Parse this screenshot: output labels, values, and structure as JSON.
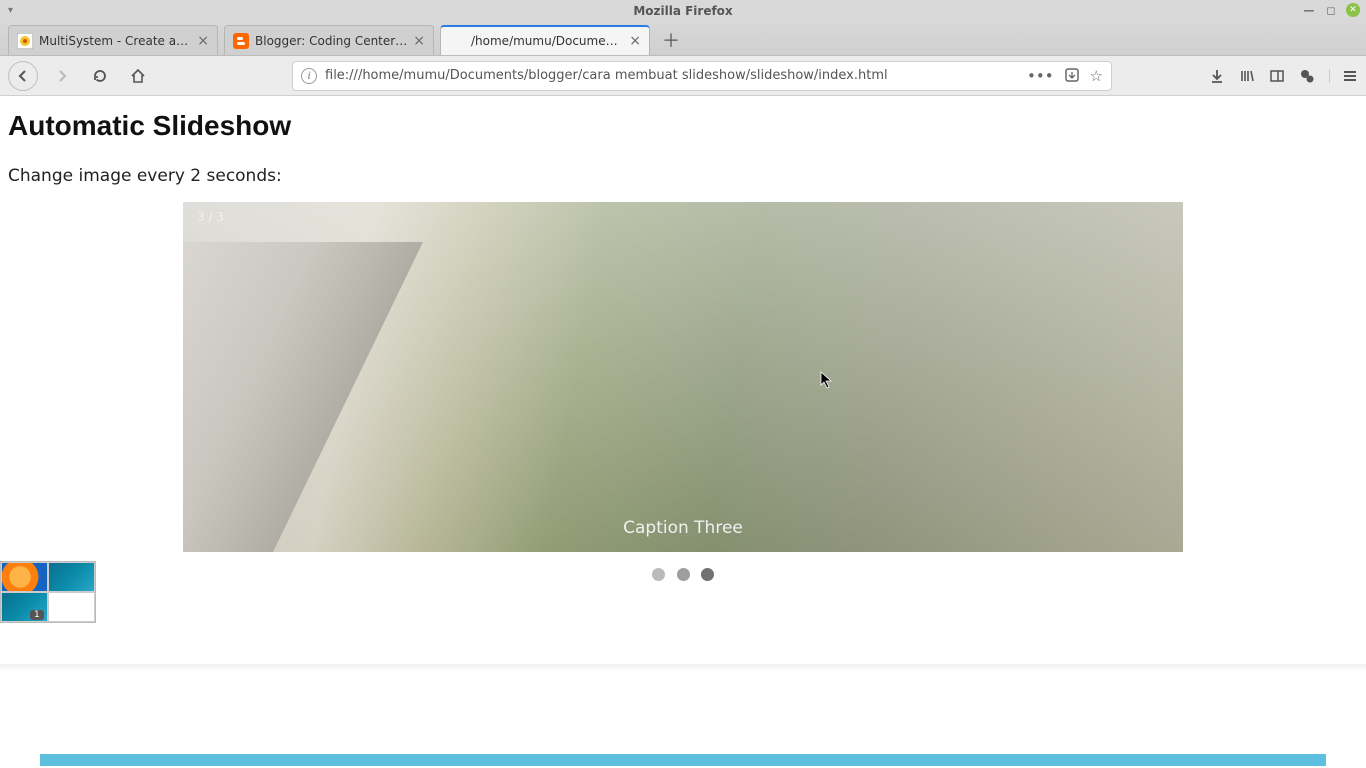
{
  "window": {
    "title": "Mozilla Firefox"
  },
  "tabs": [
    {
      "label": "MultiSystem - Create a MultiB",
      "favicon": "multisystem"
    },
    {
      "label": "Blogger: Coding Center - Sem",
      "favicon": "blogger"
    },
    {
      "label": "/home/mumu/Documents/blogge",
      "favicon": "file",
      "active": true
    }
  ],
  "url": "file:///home/mumu/Documents/blogger/cara membuat slideshow/slideshow/index.html",
  "page": {
    "heading": "Automatic Slideshow",
    "subtext": "Change image every 2 seconds:",
    "slide_number": "3 / 3",
    "caption": "Caption Three",
    "dots": {
      "total": 3,
      "active_index": 2
    }
  },
  "thumbs": {
    "badge": "1"
  }
}
